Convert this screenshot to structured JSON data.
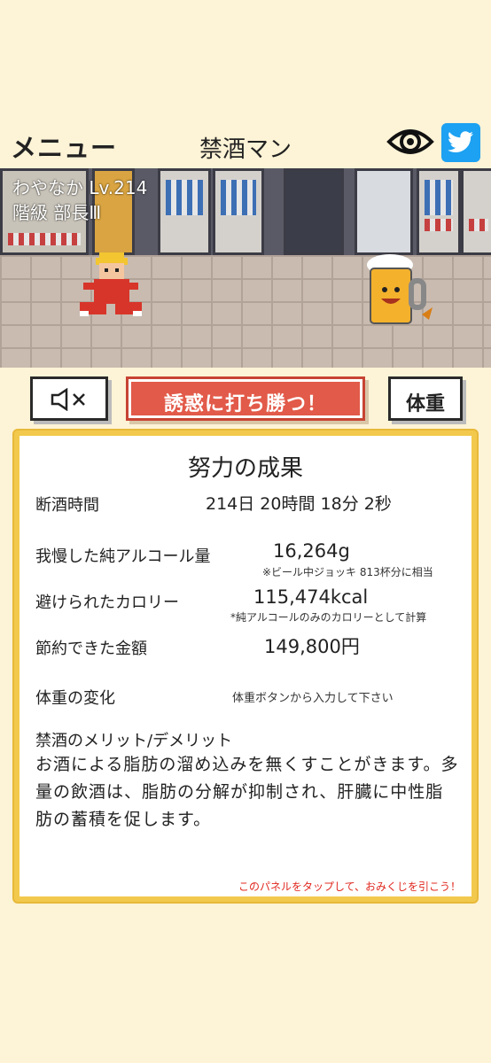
{
  "header": {
    "menu_label": "メニュー",
    "title": "禁酒マン"
  },
  "scene": {
    "player_name_level": "わやなか Lv.214",
    "rank": "階級 部長Ⅲ"
  },
  "buttons": {
    "win": "誘惑に打ち勝つ！",
    "weight": "体重"
  },
  "panel": {
    "title": "努力の成果",
    "abstinence_label": "断酒時間",
    "abstinence_value": "214日 20時間 18分 2秒",
    "alcohol_label": "我慢した純アルコール量",
    "alcohol_value": "16,264g",
    "alcohol_note": "※ビール中ジョッキ 813杯分に相当",
    "calorie_label": "避けられたカロリー",
    "calorie_value": "115,474kcal",
    "calorie_note": "*純アルコールのみのカロリーとして計算",
    "money_label": "節約できた金額",
    "money_value": "149,800円",
    "weight_label": "体重の変化",
    "weight_value": "体重ボタンから入力して下さい",
    "merit_label": "禁酒のメリット/デメリット",
    "merit_text": "お酒による脂肪の溜め込みを無くすことがきます。多量の飲酒は、脂肪の分解が抑制され、肝臓に中性脂肪の蓄積を促します。",
    "footer": "このパネルをタップして、おみくじを引こう！"
  },
  "colors": {
    "background": "#fdf3d6",
    "accent_red": "#e25a49",
    "panel_border": "#f2c94c",
    "twitter": "#1da1f2"
  },
  "icons": [
    "eye-icon",
    "twitter-icon",
    "speaker-mute-icon"
  ]
}
